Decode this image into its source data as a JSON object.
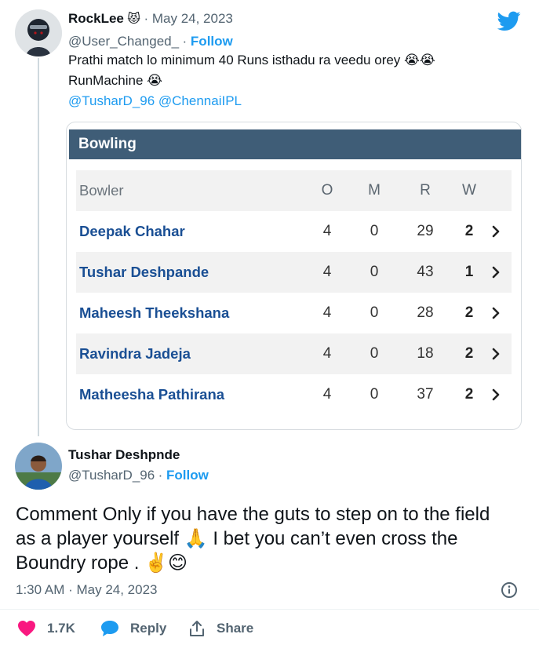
{
  "colors": {
    "accent": "#1d9bf0",
    "heart": "#f91880",
    "card_header": "#3f5d77",
    "bowler_link": "#1a4f94"
  },
  "quoted": {
    "name": "RockLee",
    "name_emoji": "😾",
    "date": "May 24, 2023",
    "handle": "@User_Changed_",
    "follow": "Follow",
    "line1": "Prathi match lo minimum 40 Runs isthadu ra veedu orey 😭😭",
    "line2": "RunMachine 😭",
    "mentions": "@TusharD_96 @ChennaiIPL"
  },
  "card": {
    "title": "Bowling",
    "headers": {
      "bowler": "Bowler",
      "o": "O",
      "m": "M",
      "r": "R",
      "w": "W"
    },
    "rows": [
      {
        "bowler": "Deepak Chahar",
        "o": "4",
        "m": "0",
        "r": "29",
        "w": "2",
        "chev": "›"
      },
      {
        "bowler": "Tushar Deshpande",
        "o": "4",
        "m": "0",
        "r": "43",
        "w": "1",
        "chev": "›"
      },
      {
        "bowler": "Maheesh Theekshana",
        "o": "4",
        "m": "0",
        "r": "28",
        "w": "2",
        "chev": "›"
      },
      {
        "bowler": "Ravindra Jadeja",
        "o": "4",
        "m": "0",
        "r": "18",
        "w": "2",
        "chev": "›"
      },
      {
        "bowler": "Matheesha Pathirana",
        "o": "4",
        "m": "0",
        "r": "37",
        "w": "2",
        "chev": "›"
      }
    ]
  },
  "tweet": {
    "name": "Tushar Deshpnde",
    "handle": "@TusharD_96",
    "follow": "Follow",
    "line1": "Comment Only if you have the guts to step on to the field",
    "line2": "as a player yourself 🙏 I bet you can’t even cross the",
    "line3": "Boundry rope .  ✌️😊",
    "timestamp": "1:30 AM · May 24, 2023",
    "likes": "1.7K",
    "reply": "Reply",
    "share": "Share"
  }
}
